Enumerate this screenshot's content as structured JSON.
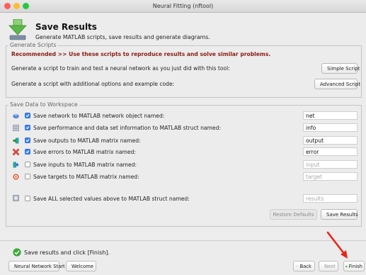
{
  "window": {
    "title": "Neural Fitting (nftool)"
  },
  "header": {
    "title": "Save Results",
    "subtitle": "Generate MATLAB scripts, save results and generate diagrams."
  },
  "generate": {
    "group_title": "Generate Scripts",
    "recommended_prefix": "Recommended >>",
    "recommended_text": "Use these scripts to reproduce results and solve similar problems.",
    "simple_text": "Generate a script to train and test a neural network as you just did with this tool:",
    "simple_button": "Simple Script",
    "advanced_text": "Generate a script with additional options and example code:",
    "advanced_button": "Advanced Script"
  },
  "save": {
    "group_title": "Save Data to Workspace",
    "rows": [
      {
        "label": "Save network to MATLAB network object named:",
        "value": "net",
        "checked": true,
        "icon": "network-icon"
      },
      {
        "label": "Save performance and data set information to MATLAB struct named:",
        "value": "info",
        "checked": true,
        "icon": "struct-icon"
      },
      {
        "label": "Save outputs to MATLAB matrix named:",
        "value": "output",
        "checked": true,
        "icon": "outputs-icon"
      },
      {
        "label": "Save errors to MATLAB matrix named:",
        "value": "error",
        "checked": true,
        "icon": "errors-icon"
      },
      {
        "label": "Save inputs to MATLAB matrix named:",
        "value": "input",
        "checked": false,
        "icon": "inputs-icon"
      },
      {
        "label": "Save targets to MATLAB matrix named:",
        "value": "target",
        "checked": false,
        "icon": "targets-icon"
      }
    ],
    "all": {
      "label": "Save ALL selected values above to MATLAB struct named:",
      "value": "results",
      "checked": false,
      "icon": "struct-all-icon"
    },
    "restore_button": "Restore Defaults",
    "save_button": "Save Results"
  },
  "footer": {
    "status": "Save results and click [Finish].",
    "start_button": "Neural Network Start",
    "welcome_button": "Welcome",
    "back_button": "Back",
    "next_button": "Next",
    "finish_button": "Finish"
  },
  "colors": {
    "recommended": "#8b1c13",
    "checkbox": "#3b82f6",
    "status_ok": "#3aa935",
    "annotation_arrow": "#e8261c"
  }
}
